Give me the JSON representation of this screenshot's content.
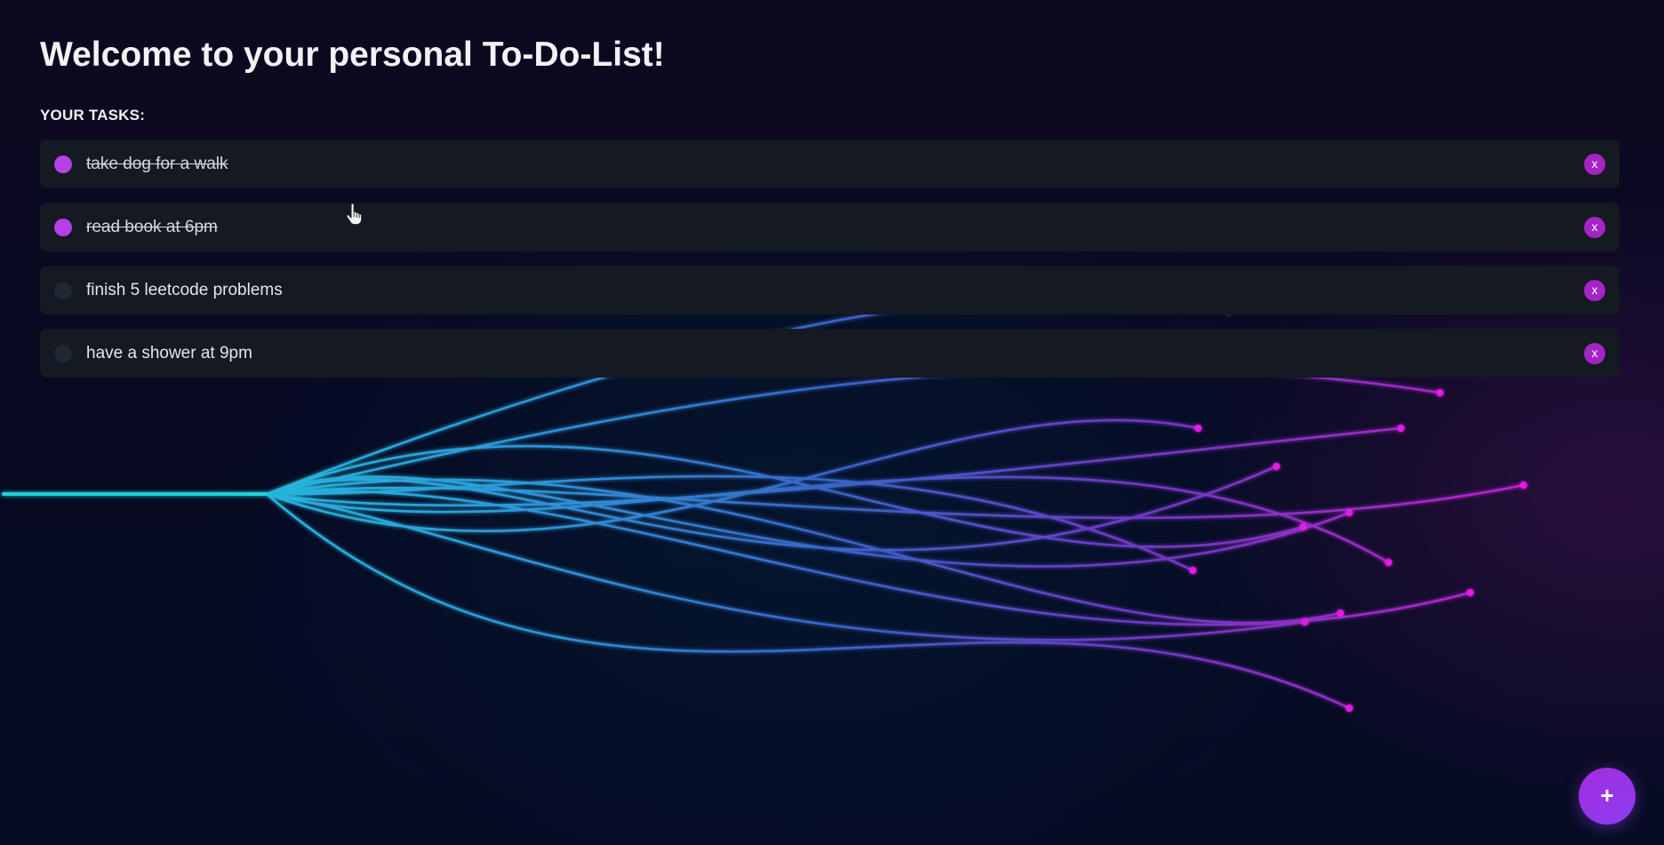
{
  "page": {
    "title": "Welcome to your personal To-Do-List!",
    "tasks_label": "YOUR TASKS:"
  },
  "tasks": [
    {
      "text": "take dog for a walk",
      "completed": true,
      "delete_label": "x"
    },
    {
      "text": "read book at 6pm",
      "completed": true,
      "delete_label": "x"
    },
    {
      "text": "finish 5 leetcode problems",
      "completed": false,
      "delete_label": "x"
    },
    {
      "text": "have a shower at 9pm",
      "completed": false,
      "delete_label": "x"
    }
  ],
  "add_button": {
    "label": "+"
  },
  "colors": {
    "accent": "#b63fe6",
    "delete": "#a524c4",
    "task_bg": "#141922",
    "line_cyan": "#22e6f0",
    "line_blue": "#3a6fd8",
    "line_purple": "#9a2fd0",
    "dot_magenta": "#e51ce5"
  },
  "icons": {
    "checkbox": "circle-check-icon",
    "delete": "close-icon",
    "add": "plus-icon",
    "cursor": "hand-pointer-icon"
  }
}
